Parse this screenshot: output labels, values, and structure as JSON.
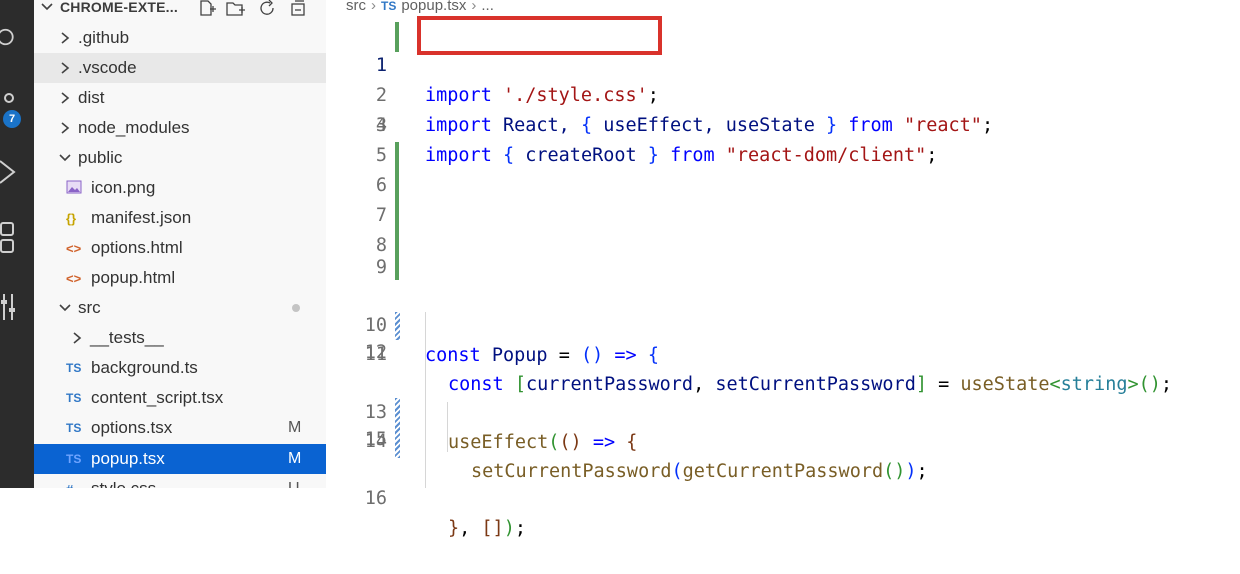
{
  "activity_bar": {
    "badge_count": "7"
  },
  "explorer": {
    "title": "CHROME-EXTE...",
    "items": [
      {
        "label": ".github",
        "type": "folder",
        "expanded": false,
        "depth": 0
      },
      {
        "label": ".vscode",
        "type": "folder",
        "expanded": false,
        "depth": 0
      },
      {
        "label": "dist",
        "type": "folder",
        "expanded": false,
        "depth": 0
      },
      {
        "label": "node_modules",
        "type": "folder",
        "expanded": false,
        "depth": 0
      },
      {
        "label": "public",
        "type": "folder",
        "expanded": true,
        "depth": 0
      },
      {
        "label": "icon.png",
        "type": "image",
        "depth": 1
      },
      {
        "label": "manifest.json",
        "type": "json",
        "icon": "{}",
        "depth": 1
      },
      {
        "label": "options.html",
        "type": "html",
        "icon": "<>",
        "depth": 1
      },
      {
        "label": "popup.html",
        "type": "html",
        "icon": "<>",
        "depth": 1
      },
      {
        "label": "src",
        "type": "folder",
        "expanded": true,
        "depth": 0
      },
      {
        "label": "__tests__",
        "type": "folder",
        "expanded": false,
        "depth": 1
      },
      {
        "label": "background.ts",
        "type": "ts",
        "icon": "TS",
        "depth": 1
      },
      {
        "label": "content_script.tsx",
        "type": "ts",
        "icon": "TS",
        "depth": 1
      },
      {
        "label": "options.tsx",
        "type": "ts",
        "icon": "TS",
        "depth": 1,
        "status": "M"
      },
      {
        "label": "popup.tsx",
        "type": "ts",
        "icon": "TS",
        "depth": 1,
        "status": "M",
        "selected": true
      },
      {
        "label": "style.css",
        "type": "css",
        "icon": "#",
        "depth": 1,
        "status": "U"
      }
    ]
  },
  "breadcrumb": {
    "folder": "src",
    "file_icon": "TS",
    "file": "popup.tsx",
    "more": "..."
  },
  "editor": {
    "line_numbers": [
      "1",
      "2",
      "3",
      "4",
      "5",
      "6",
      "7",
      "8",
      "9",
      "10",
      "11",
      "12",
      "13",
      "14",
      "15",
      "16"
    ],
    "line1": {
      "kw": "import",
      "str": "'./style.css'",
      "semi": ";"
    },
    "line2": {
      "kw": "import",
      "name": "React,",
      "ob": "{",
      "items": "useEffect, useState",
      "cb": "}",
      "from": "from",
      "str": "\"react\"",
      "semi": ";"
    },
    "line3": {
      "kw": "import",
      "ob": "{",
      "items": "createRoot",
      "cb": "}",
      "from": "from",
      "str": "\"react-dom/client\"",
      "semi": ";"
    },
    "line10": {
      "kw": "const",
      "name": "Popup",
      "eq": "=",
      "parens": "()",
      "arrow": "=>",
      "ob": "{"
    },
    "line11": {
      "kw": "const",
      "ob": "[",
      "a": "currentPassword",
      "comma": ",",
      "b": "setCurrentPassword",
      "cb": "]",
      "eq": "=",
      "fn": "useState",
      "lt": "<",
      "type": "string",
      "gt": ">",
      "parens": "()",
      "semi": ";"
    },
    "line13": {
      "fn": "useEffect",
      "op": "(",
      "parens": "()",
      "arrow": "=>",
      "ob": "{"
    },
    "line14": {
      "fn": "setCurrentPassword",
      "op": "(",
      "fn2": "getCurrentPassword",
      "parens": "()",
      "cp": ")",
      "semi": ";"
    },
    "line16": {
      "cb": "}",
      "comma": ",",
      "arr": "[]",
      "cp": ")",
      "semi": ";"
    }
  }
}
